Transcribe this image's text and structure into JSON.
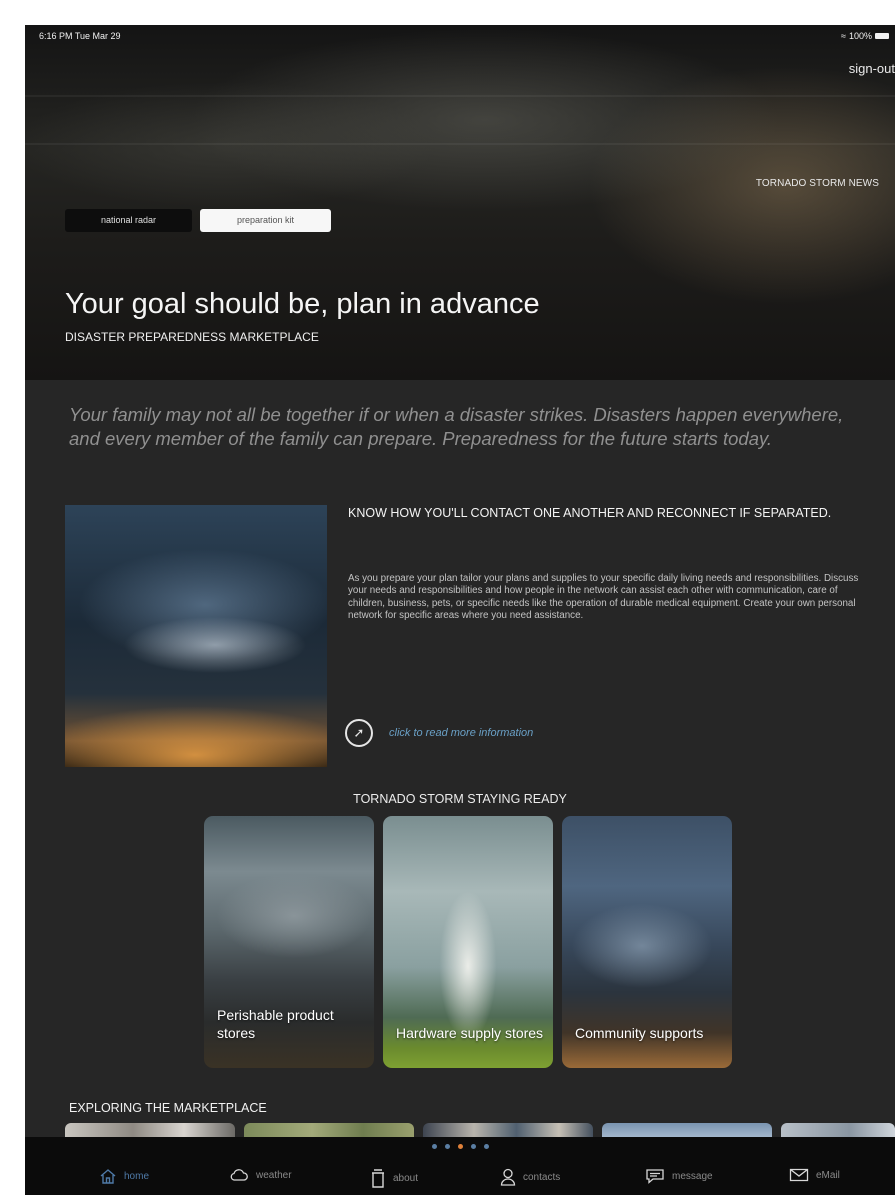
{
  "status_bar": {
    "time": "6:16 PM  Tue Mar 29",
    "battery": "100%"
  },
  "header": {
    "signout": "sign-out",
    "news_label": "TORNADO STORM NEWS",
    "tabs": [
      {
        "label": "national radar",
        "selected": false
      },
      {
        "label": "preparation kit",
        "selected": true
      }
    ],
    "title": "Your goal should be, plan in advance",
    "subtitle": "DISASTER PREPAREDNESS MARKETPLACE"
  },
  "intro": "Your family may not all be together if or when a disaster strikes. Disasters happen everywhere, and every member of the family can prepare. Preparedness for the future starts today.",
  "feature": {
    "heading": "KNOW HOW YOU'LL CONTACT ONE ANOTHER AND RECONNECT IF SEPARATED.",
    "body": "As you prepare your plan tailor your plans and supplies to your specific daily living needs and responsibilities. Discuss your needs and responsibilities and how people in the network can assist each other with communication, care of children, business, pets, or specific needs like the operation of durable medical equipment. Create your own personal network for specific areas where you need assistance.",
    "read_more": "click to read more information",
    "icon": "compass-icon"
  },
  "cards_section": {
    "heading": "TORNADO STORM STAYING READY",
    "cards": [
      {
        "label": "Perishable product stores"
      },
      {
        "label": "Hardware supply stores"
      },
      {
        "label": "Community supports"
      }
    ]
  },
  "marketplace": {
    "heading": "EXPLORING THE MARKETPLACE"
  },
  "pager": {
    "count": 5,
    "active_index": 2
  },
  "tabbar": {
    "items": [
      {
        "label": "home",
        "icon": "home-icon",
        "active": true
      },
      {
        "label": "weather",
        "icon": "cloud-icon",
        "active": false
      },
      {
        "label": "about",
        "icon": "trash-icon",
        "active": false
      },
      {
        "label": "contacts",
        "icon": "person-icon",
        "active": false
      },
      {
        "label": "message",
        "icon": "message-icon",
        "active": false
      },
      {
        "label": "eMail",
        "icon": "envelope-icon",
        "active": false
      }
    ]
  },
  "colors": {
    "background": "#262626",
    "tabbar": "#0b0b0b",
    "accent_link": "#6aa0c6",
    "active_tab": "#4f7aa8",
    "active_dot": "#e0813a",
    "inactive_dot": "#5a7ea3"
  }
}
